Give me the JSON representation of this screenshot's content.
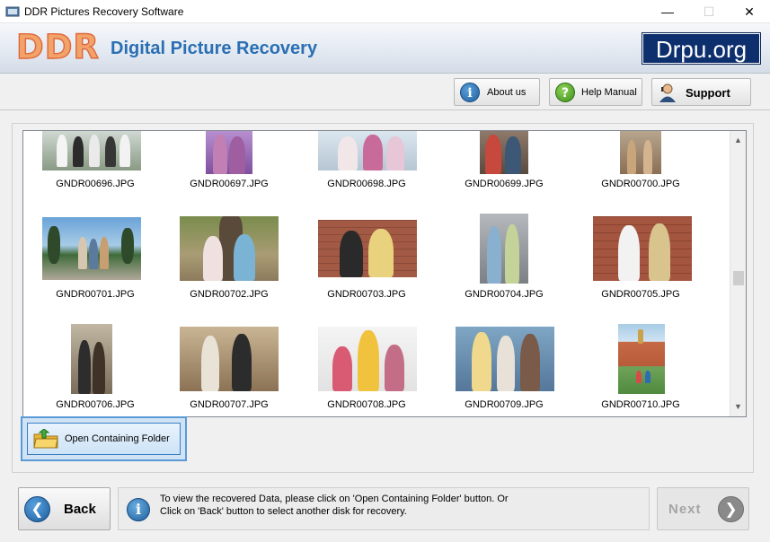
{
  "window": {
    "title": "DDR Pictures Recovery Software",
    "minimize_glyph": "—",
    "maximize_glyph": "☐",
    "close_glyph": "✕"
  },
  "banner": {
    "logo": "DDR",
    "app_name": "Digital Picture Recovery",
    "site": "Drpu.org"
  },
  "toolbar": {
    "about_label": "About us",
    "help_label": "Help Manual",
    "support_label": "Support"
  },
  "gallery": {
    "items": [
      {
        "name": "GNDR00696.JPG"
      },
      {
        "name": "GNDR00697.JPG"
      },
      {
        "name": "GNDR00698.JPG"
      },
      {
        "name": "GNDR00699.JPG"
      },
      {
        "name": "GNDR00700.JPG"
      },
      {
        "name": "GNDR00701.JPG"
      },
      {
        "name": "GNDR00702.JPG"
      },
      {
        "name": "GNDR00703.JPG"
      },
      {
        "name": "GNDR00704.JPG"
      },
      {
        "name": "GNDR00705.JPG"
      },
      {
        "name": "GNDR00706.JPG"
      },
      {
        "name": "GNDR00707.JPG"
      },
      {
        "name": "GNDR00708.JPG"
      },
      {
        "name": "GNDR00709.JPG"
      },
      {
        "name": "GNDR00710.JPG"
      }
    ]
  },
  "actions": {
    "open_folder_label": "Open Containing Folder"
  },
  "footer": {
    "back_label": "Back",
    "next_label": "Next",
    "info_line1": "To view the recovered Data, please click on 'Open Containing Folder' button. Or",
    "info_line2": "Click on 'Back' button to select another disk for recovery."
  },
  "colors": {
    "accent": "#2a6fb3",
    "logo": "#f2a36a",
    "site_badge": "#0e2f6e",
    "selection": "#5b9bd5"
  },
  "icons": {
    "about": "info-icon",
    "help": "help-question-icon",
    "support": "support-person-icon",
    "folder": "open-folder-icon",
    "back": "back-arrow-icon",
    "next": "next-arrow-icon"
  }
}
